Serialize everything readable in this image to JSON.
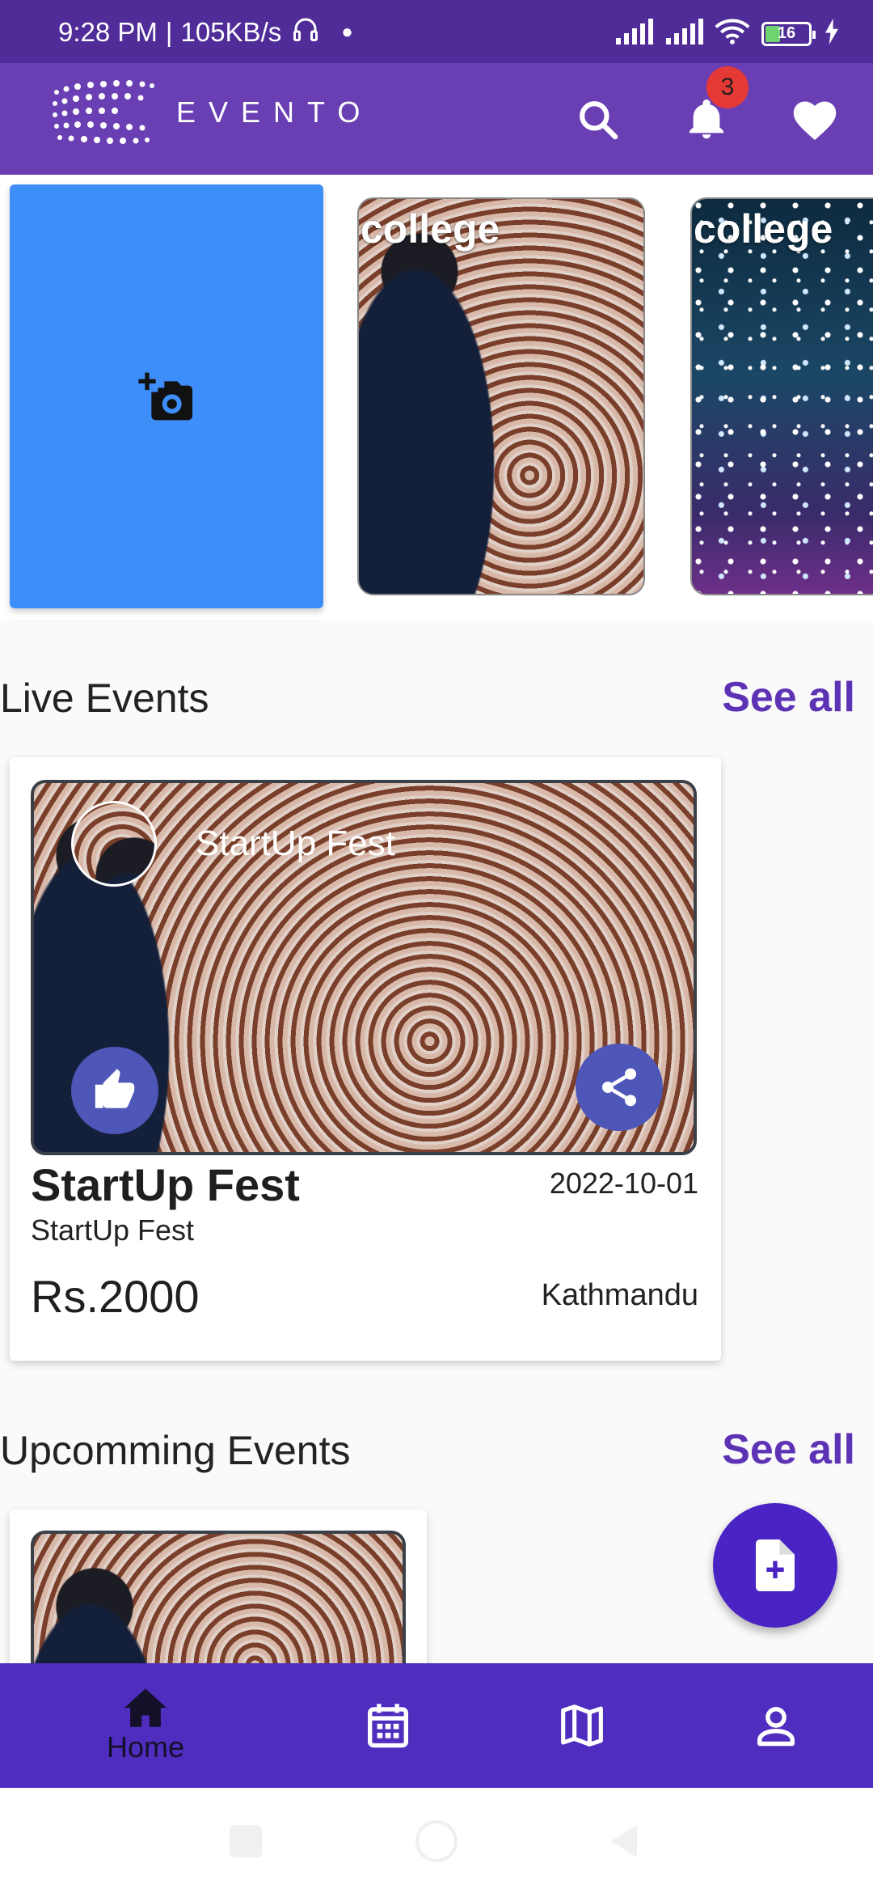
{
  "status_bar": {
    "time": "9:28 PM",
    "separator": "|",
    "speed": "105KB/s",
    "battery": "16"
  },
  "app_bar": {
    "brand": "EVENTO",
    "notification_count": "3"
  },
  "stories": [
    {
      "label": "college"
    },
    {
      "label": "college"
    }
  ],
  "live_events": {
    "title": "Live Events",
    "see_all": "See all",
    "card": {
      "overlay_title": "StartUp Fest",
      "name": "StartUp Fest",
      "subtitle": "StartUp Fest",
      "date": "2022-10-01",
      "price": "Rs.2000",
      "location": "Kathmandu"
    }
  },
  "upcoming_events": {
    "title": "Upcomming Events",
    "see_all": "See all"
  },
  "bottom_nav": {
    "items": [
      {
        "label": "Home",
        "icon": "home-icon"
      },
      {
        "icon": "calendar-icon"
      },
      {
        "icon": "map-icon"
      },
      {
        "icon": "profile-icon"
      }
    ]
  },
  "colors": {
    "status_bar": "#4f2c98",
    "app_bar": "#6a3fb4",
    "accent": "#5d33b5",
    "add_story": "#3d8ef8",
    "fab": "#4a23c4",
    "bottom_nav": "#4e2dbf"
  }
}
